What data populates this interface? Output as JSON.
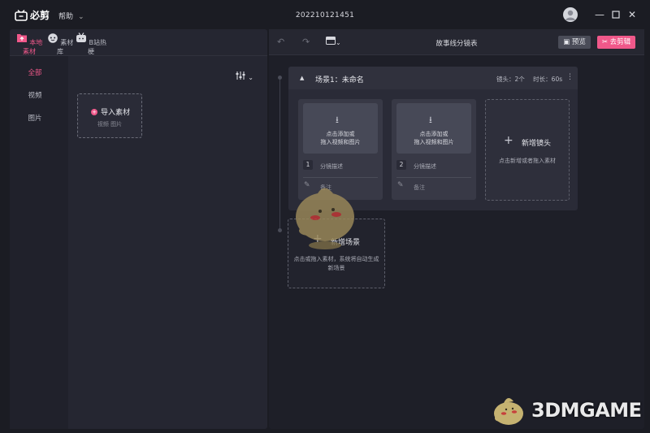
{
  "app": {
    "logo_text": "必剪",
    "help_label": "帮助",
    "window_title": "202210121451"
  },
  "left": {
    "tabs": [
      {
        "label": "本地素材",
        "active": true
      },
      {
        "label": "素材库",
        "active": false
      },
      {
        "label": "B站热梗",
        "active": false
      }
    ],
    "categories": [
      {
        "label": "全部",
        "active": true
      },
      {
        "label": "视频",
        "active": false
      },
      {
        "label": "图片",
        "active": false
      }
    ],
    "import_card": {
      "title": "导入素材",
      "subtitle": "视频 图片"
    }
  },
  "right": {
    "toolbar": {
      "title": "故事线分镜表",
      "preview_label": "预览",
      "edit_label": "去剪辑"
    },
    "scene": {
      "name": "场景1：未命名",
      "shot_count_label": "镜头：2个",
      "duration_label": "时长：60s",
      "shots": [
        {
          "number": "1",
          "thumb_line1": "点击添加或",
          "thumb_line2": "拖入视频和图片",
          "desc": "分镜描述",
          "note": "备注"
        },
        {
          "number": "2",
          "thumb_line1": "点击添加或",
          "thumb_line2": "拖入视频和图片",
          "desc": "分镜描述",
          "note": "备注"
        }
      ],
      "add_shot": {
        "title": "新增镜头",
        "subtitle": "点击新增或者拖入素材"
      }
    },
    "add_scene": {
      "title": "新增场景",
      "subtitle": "点击或拖入素材，系统将自动生成新场景"
    }
  },
  "watermark": {
    "text": "3DMGAME"
  },
  "colors": {
    "accent": "#f0588a",
    "background": "#1b1c23",
    "panel": "#252631"
  }
}
